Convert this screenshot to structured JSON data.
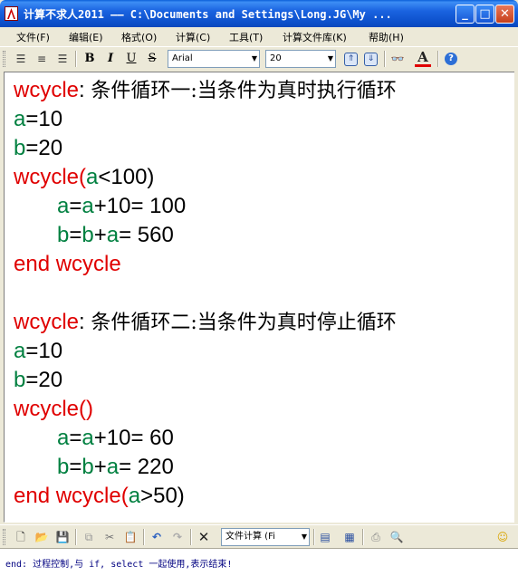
{
  "window": {
    "title": "计算不求人2011 —— C:\\Documents and Settings\\Long.JG\\My ...",
    "buttons": {
      "minimize": "_",
      "maximize": "□",
      "close": "✕"
    }
  },
  "menubar": {
    "items": [
      "文件(F)",
      "编辑(E)",
      "格式(O)",
      "计算(C)",
      "工具(T)",
      "计算文件库(K)",
      "帮助(H)"
    ]
  },
  "format_toolbar": {
    "font_name": "Arial",
    "font_size": "20",
    "bold": "B",
    "italic": "I",
    "underline": "U",
    "strike": "S"
  },
  "document": {
    "lines": [
      {
        "parts": [
          {
            "t": "wcycle",
            "c": "kw"
          },
          {
            "t": ": ",
            "c": "tx"
          },
          {
            "t": "条件循环一:当条件为真时执行循环",
            "c": "cn"
          }
        ]
      },
      {
        "parts": [
          {
            "t": "a",
            "c": "var"
          },
          {
            "t": "=10",
            "c": "tx"
          }
        ]
      },
      {
        "parts": [
          {
            "t": "b",
            "c": "var"
          },
          {
            "t": "=20",
            "c": "tx"
          }
        ]
      },
      {
        "parts": [
          {
            "t": "wcycle(",
            "c": "kw"
          },
          {
            "t": "a",
            "c": "var"
          },
          {
            "t": "<100)",
            "c": "tx"
          }
        ]
      },
      {
        "indent": true,
        "parts": [
          {
            "t": "a",
            "c": "var"
          },
          {
            "t": "=",
            "c": "tx"
          },
          {
            "t": "a",
            "c": "var"
          },
          {
            "t": "+10= 100",
            "c": "tx"
          }
        ]
      },
      {
        "indent": true,
        "parts": [
          {
            "t": "b",
            "c": "var"
          },
          {
            "t": "=",
            "c": "tx"
          },
          {
            "t": "b",
            "c": "var"
          },
          {
            "t": "+",
            "c": "tx"
          },
          {
            "t": "a",
            "c": "var"
          },
          {
            "t": "= 560",
            "c": "tx"
          }
        ]
      },
      {
        "parts": [
          {
            "t": "end wcycle",
            "c": "kw"
          }
        ]
      },
      {
        "parts": []
      },
      {
        "parts": [
          {
            "t": "wcycle",
            "c": "kw"
          },
          {
            "t": ": ",
            "c": "tx"
          },
          {
            "t": "条件循环二:当条件为真时停止循环",
            "c": "cn"
          }
        ]
      },
      {
        "parts": [
          {
            "t": "a",
            "c": "var"
          },
          {
            "t": "=10",
            "c": "tx"
          }
        ]
      },
      {
        "parts": [
          {
            "t": "b",
            "c": "var"
          },
          {
            "t": "=20",
            "c": "tx"
          }
        ]
      },
      {
        "parts": [
          {
            "t": "wcycle()",
            "c": "kw"
          }
        ]
      },
      {
        "indent": true,
        "parts": [
          {
            "t": "a",
            "c": "var"
          },
          {
            "t": "=",
            "c": "tx"
          },
          {
            "t": "a",
            "c": "var"
          },
          {
            "t": "+10= 60",
            "c": "tx"
          }
        ]
      },
      {
        "indent": true,
        "parts": [
          {
            "t": "b",
            "c": "var"
          },
          {
            "t": "=",
            "c": "tx"
          },
          {
            "t": "b",
            "c": "var"
          },
          {
            "t": "+",
            "c": "tx"
          },
          {
            "t": "a",
            "c": "var"
          },
          {
            "t": "= 220",
            "c": "tx"
          }
        ]
      },
      {
        "parts": [
          {
            "t": "end wcycle(",
            "c": "kw"
          },
          {
            "t": "a",
            "c": "var"
          },
          {
            "t": ">50)",
            "c": "tx"
          }
        ]
      }
    ]
  },
  "bottom_toolbar": {
    "calc_select": "文件计算 (Fi"
  },
  "statusbar": {
    "text": "end: 过程控制,与 if, select 一起使用,表示结束!"
  },
  "colors": {
    "keyword": "#e00000",
    "variable": "#008040",
    "titlebar": "#0b4ec9"
  }
}
